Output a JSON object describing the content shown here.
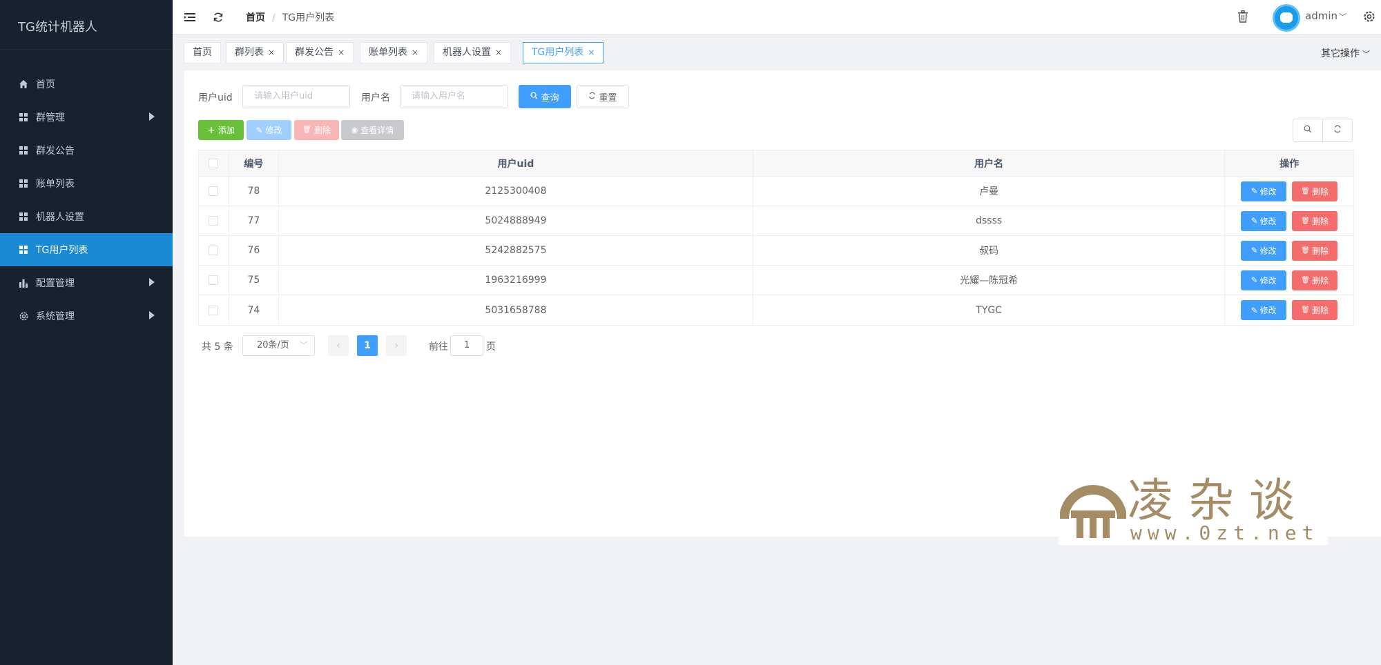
{
  "app": {
    "title": "TG统计机器人"
  },
  "sidebar": {
    "items": [
      {
        "label": "首页",
        "icon": "home-icon"
      },
      {
        "label": "群管理",
        "icon": "grid-icon"
      },
      {
        "label": "群发公告",
        "icon": "grid-icon"
      },
      {
        "label": "账单列表",
        "icon": "grid-icon"
      },
      {
        "label": "机器人设置",
        "icon": "grid-icon"
      },
      {
        "label": "TG用户列表",
        "icon": "grid-icon"
      },
      {
        "label": "配置管理",
        "icon": "bar-chart-icon"
      },
      {
        "label": "系统管理",
        "icon": "gear-icon"
      }
    ],
    "active_index": 5
  },
  "header": {
    "breadcrumb": {
      "home": "首页",
      "separator": "/",
      "current": "TG用户列表"
    },
    "user": "admin"
  },
  "tags": {
    "items": [
      {
        "label": "首页",
        "closable": false
      },
      {
        "label": "群列表",
        "closable": true
      },
      {
        "label": "群发公告",
        "closable": true
      },
      {
        "label": "账单列表",
        "closable": true
      },
      {
        "label": "机器人设置",
        "closable": true
      },
      {
        "label": "TG用户列表",
        "closable": true
      }
    ],
    "close_glyph": "×",
    "other_ops": "其它操作"
  },
  "search": {
    "uid_label": "用户uid",
    "uid_placeholder": "请输入用户uid",
    "name_label": "用户名",
    "name_placeholder": "请输入用户名",
    "query_label": "查询",
    "reset_label": "重置"
  },
  "toolbar": {
    "add_label": "添加",
    "edit_label": "修改",
    "delete_label": "删除",
    "detail_label": "查看详情"
  },
  "table": {
    "headers": {
      "id": "编号",
      "uid": "用户uid",
      "name": "用户名",
      "op": "操作"
    },
    "rows": [
      {
        "id": "78",
        "uid": "2125300408",
        "name": "卢曼"
      },
      {
        "id": "77",
        "uid": "5024888949",
        "name": "dssss"
      },
      {
        "id": "76",
        "uid": "5242882575",
        "name": "叔码"
      },
      {
        "id": "75",
        "uid": "1963216999",
        "name": "光耀—陈冠希"
      },
      {
        "id": "74",
        "uid": "5031658788",
        "name": "TYGC"
      }
    ],
    "row_edit_label": "修改",
    "row_delete_label": "删除"
  },
  "pagination": {
    "total_text": "共 5 条",
    "page_size": "20条/页",
    "current_page": "1",
    "goto_label": "前往",
    "goto_value": "1",
    "page_suffix": "页"
  },
  "watermark": {
    "cn": "凌杂谈",
    "en": "www.0zt.net"
  },
  "colors": {
    "sidebar_bg": "#18212f",
    "active_menu": "#1a8ad4",
    "primary": "#409eff",
    "success": "#67c23a",
    "danger": "#f56c6c",
    "watermark": "#a58c64"
  }
}
